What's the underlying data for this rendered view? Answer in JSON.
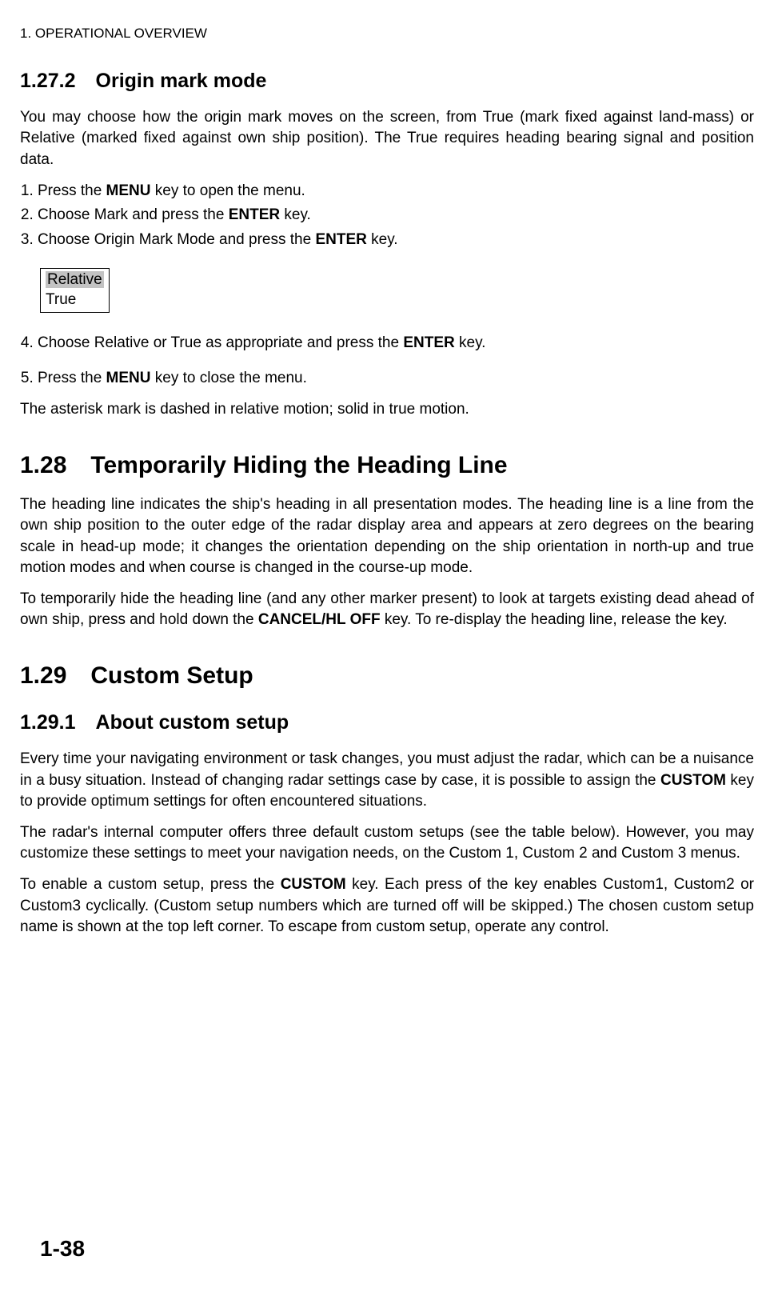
{
  "header": "1. OPERATIONAL OVERVIEW",
  "s1": {
    "num": "1.27.2",
    "title": "Origin mark mode",
    "p1a": "You may choose how the origin mark moves on the screen, from True (mark fixed against land-mass) or Relative (marked fixed against own ship position). The True requires heading bearing signal and position data.",
    "li1a": "Press the ",
    "li1b": "MENU",
    "li1c": " key to open the menu.",
    "li2a": "Choose Mark and press the ",
    "li2b": "ENTER",
    "li2c": " key.",
    "li3a": "Choose Origin Mark Mode and press the ",
    "li3b": "ENTER",
    "li3c": " key.",
    "opt1": "Relative",
    "opt2": "True",
    "li4a": "Choose Relative or True as appropriate and press the ",
    "li4b": "ENTER",
    "li4c": " key.",
    "li5a": "Press the ",
    "li5b": "MENU",
    "li5c": " key to close the menu.",
    "p2": "The asterisk mark is dashed in relative motion; solid in true motion."
  },
  "s2": {
    "num": "1.28",
    "title": "Temporarily Hiding the Heading Line",
    "p1": "The heading line indicates the ship's heading in all presentation modes. The heading line is a line from the own ship position to the outer edge of the radar display area and appears at zero degrees on the bearing scale in head-up mode; it changes the orientation depending on the ship orientation in north-up and true motion modes and when course is changed in the course-up mode.",
    "p2a": "To temporarily hide the heading line (and any other marker present) to look at targets existing dead ahead of own ship, press and hold down the ",
    "p2b": "CANCEL/HL OFF",
    "p2c": " key. To re-display the heading line, release the key."
  },
  "s3": {
    "num": "1.29",
    "title": "Custom Setup",
    "sub_num": "1.29.1",
    "sub_title": "About custom setup",
    "p1a": "Every time your navigating environment or task changes, you must adjust the radar, which can be a nuisance in a busy situation. Instead of changing radar settings case by case, it is possible to assign the ",
    "p1b": "CUSTOM",
    "p1c": " key to provide optimum settings for often encountered situations.",
    "p2": "The radar's internal computer offers three default custom setups (see the table below). However, you may customize these settings to meet your navigation needs, on the Custom 1, Custom 2 and Custom 3 menus.",
    "p3a": "To enable a custom setup, press the ",
    "p3b": "CUSTOM",
    "p3c": " key. Each press of the key enables Custom1, Custom2 or Custom3 cyclically. (Custom setup numbers which are turned off will be skipped.) The chosen custom setup name is shown at the top left corner. To escape from custom setup, operate any control."
  },
  "page_number": "1-38"
}
